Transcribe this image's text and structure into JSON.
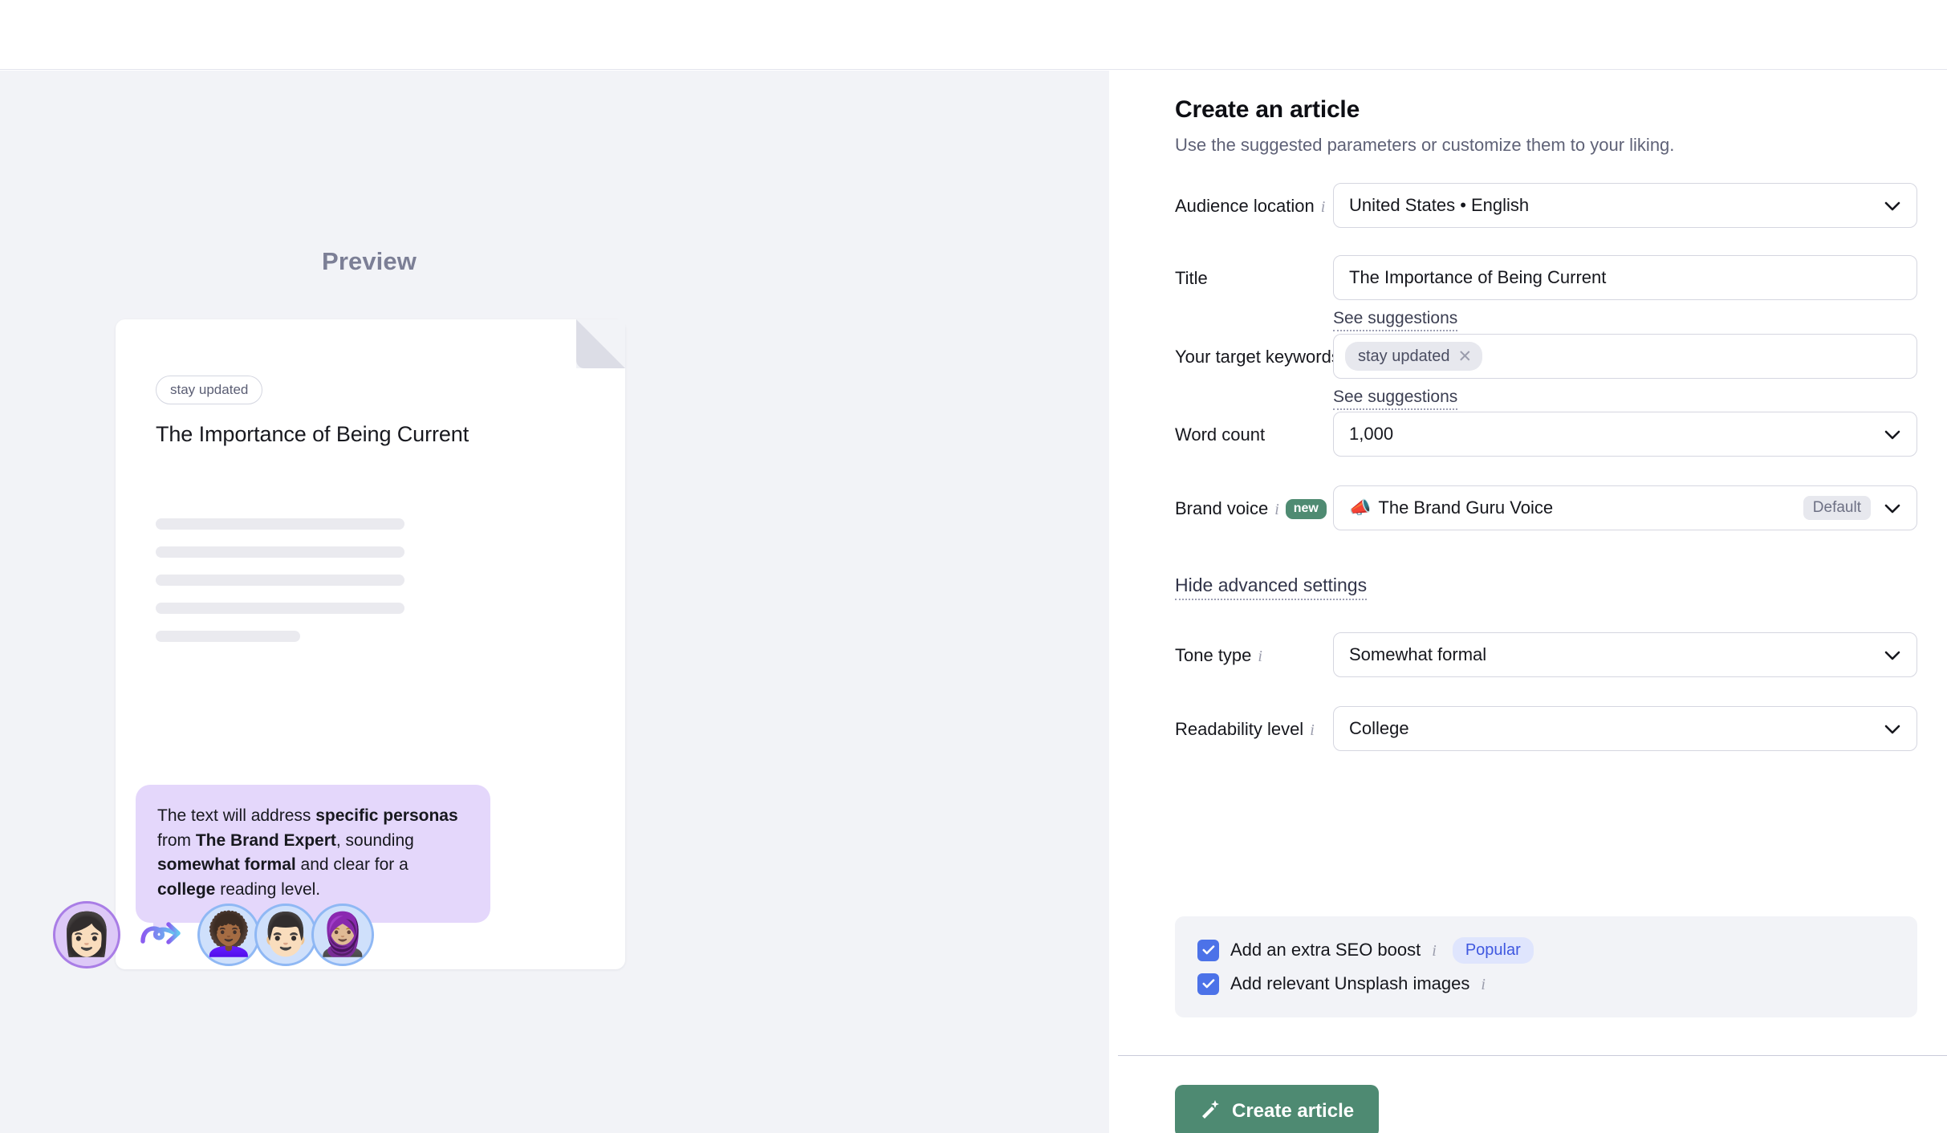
{
  "preview": {
    "title": "Preview",
    "card": {
      "tag": "stay updated",
      "heading": "The Importance of Being Current"
    },
    "callout": {
      "part1": "The text will address ",
      "bold1": "specific personas",
      "part2": " from ",
      "bold2": "The Brand Expert",
      "part3": ", sounding ",
      "bold3": "somewhat formal",
      "part4": " and clear for a ",
      "bold4": "college",
      "part5": " reading level."
    },
    "avatars": {
      "brand": "👩🏻",
      "personas": [
        "👩🏾‍🦱",
        "👨🏻",
        "🧕🏼"
      ]
    }
  },
  "form": {
    "title": "Create an article",
    "subtitle": "Use the suggested parameters or customize them to your liking.",
    "fields": {
      "audience_location": {
        "label": "Audience location",
        "value": "United States • English"
      },
      "title": {
        "label": "Title",
        "value": "The Importance of Being Current",
        "see_suggestions": "See suggestions"
      },
      "keywords": {
        "label": "Your target keywords",
        "chips": [
          "stay updated"
        ],
        "remove_symbol": "✕",
        "see_suggestions": "See suggestions"
      },
      "word_count": {
        "label": "Word count",
        "value": "1,000"
      },
      "brand_voice": {
        "label": "Brand voice",
        "badge": "new",
        "emoji": "📣",
        "value": "The Brand Guru Voice",
        "default_badge": "Default"
      },
      "tone_type": {
        "label": "Tone type",
        "value": "Somewhat formal"
      },
      "readability_level": {
        "label": "Readability level",
        "value": "College"
      }
    },
    "advanced_toggle": "Hide advanced settings",
    "options": [
      {
        "label": "Add an extra SEO boost",
        "checked": true,
        "badge": "Popular"
      },
      {
        "label": "Add relevant Unsplash images",
        "checked": true,
        "badge": ""
      }
    ],
    "submit": "Create article"
  },
  "colors": {
    "accent_green": "#4e8a72",
    "checkbox_blue": "#4c72e8",
    "popular_blue": "#3f58e0",
    "callout_purple": "#e4d7fb",
    "panel_gray": "#f2f3f7"
  }
}
